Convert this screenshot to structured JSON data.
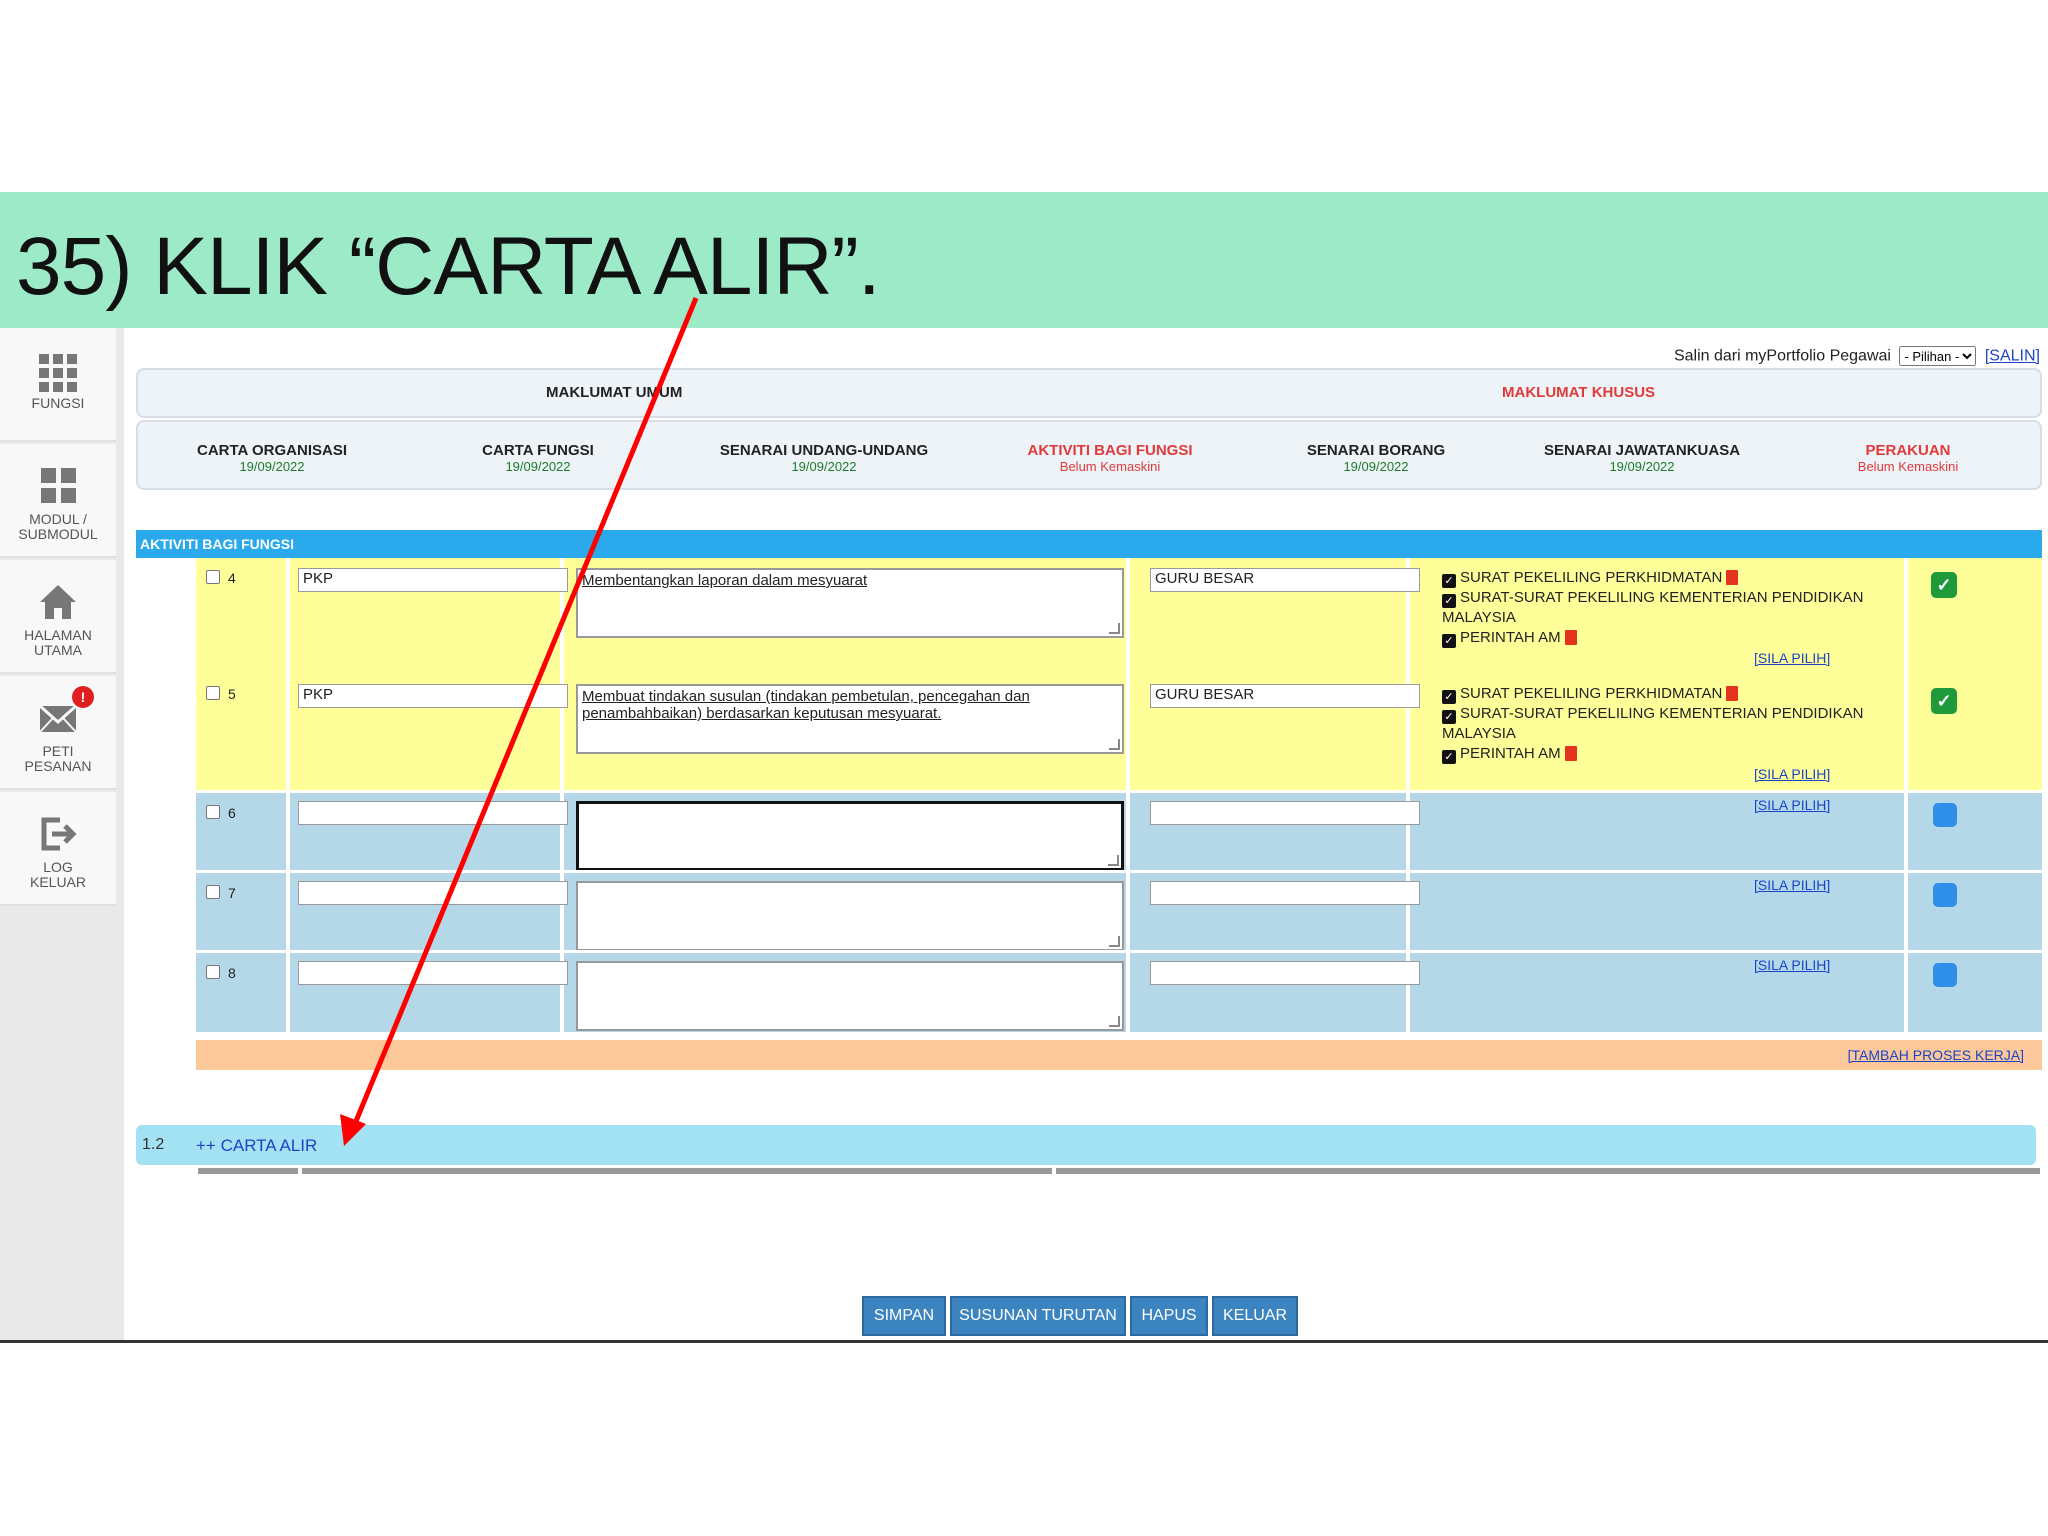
{
  "instruction": "35) KLIK “CARTA ALIR”.",
  "sidebar": {
    "items": [
      {
        "label": "FUNGSI",
        "icon": "grid-icon"
      },
      {
        "label": "MODUL / SUBMODUL",
        "icon": "modules-icon"
      },
      {
        "label": "HALAMAN UTAMA",
        "icon": "home-icon"
      },
      {
        "label": "PETI PESANAN",
        "icon": "mail-icon",
        "badge": "!"
      },
      {
        "label": "LOG KELUAR",
        "icon": "logout-icon"
      }
    ]
  },
  "copy": {
    "label": "Salin dari myPortfolio Pegawai",
    "select_value": "- Pilihan -",
    "link": "[SALIN]"
  },
  "main_tabs": {
    "umum": "MAKLUMAT UMUM",
    "khusus": "MAKLUMAT KHUSUS"
  },
  "sub_tabs": [
    {
      "name": "CARTA ORGANISASI",
      "date": "19/09/2022"
    },
    {
      "name": "CARTA FUNGSI",
      "date": "19/09/2022"
    },
    {
      "name": "SENARAI UNDANG-UNDANG",
      "date": "19/09/2022"
    },
    {
      "name": "AKTIVITI BAGI FUNGSI",
      "date": "Belum Kemaskini"
    },
    {
      "name": "SENARAI BORANG",
      "date": "19/09/2022"
    },
    {
      "name": "SENARAI JAWATANKUASA",
      "date": "19/09/2022"
    },
    {
      "name": "PERAKUAN",
      "date": "Belum Kemaskini"
    }
  ],
  "section_title": "AKTIVITI BAGI FUNGSI",
  "rows": [
    {
      "no": "4",
      "code": "PKP",
      "desc": "Membentangkan laporan dalam mesyuarat",
      "officer": "GURU BESAR",
      "docs": [
        "SURAT PEKELILING PERKHIDMATAN",
        "SURAT-SURAT PEKELILING KEMENTERIAN PENDIDIKAN MALAYSIA",
        "PERINTAH AM"
      ],
      "link": "[SILA PILIH]",
      "status": "done"
    },
    {
      "no": "5",
      "code": "PKP",
      "desc": "Membuat tindakan susulan (tindakan pembetulan, pencegahan dan penambahbaikan)  berdasarkan keputusan mesyuarat.",
      "officer": "GURU BESAR",
      "docs": [
        "SURAT PEKELILING PERKHIDMATAN",
        "SURAT-SURAT PEKELILING KEMENTERIAN PENDIDIKAN MALAYSIA",
        "PERINTAH AM"
      ],
      "link": "[SILA PILIH]",
      "status": "done"
    },
    {
      "no": "6",
      "code": "",
      "desc": "",
      "officer": "",
      "docs": [],
      "link": "[SILA PILIH]",
      "status": "empty"
    },
    {
      "no": "7",
      "code": "",
      "desc": "",
      "officer": "",
      "docs": [],
      "link": "[SILA PILIH]",
      "status": "empty"
    },
    {
      "no": "8",
      "code": "",
      "desc": "",
      "officer": "",
      "docs": [],
      "link": "[SILA PILIH]",
      "status": "empty"
    }
  ],
  "add_process": "[TAMBAH PROSES KERJA]",
  "carta": {
    "num": "1.2",
    "label": "++ CARTA ALIR"
  },
  "buttons": {
    "simpan": "SIMPAN",
    "susunan": "SUSUNAN TURUTAN",
    "hapus": "HAPUS",
    "keluar": "KELUAR"
  },
  "colors": {
    "banner": "#9ceac8",
    "section": "#2aa9ec",
    "filled_row": "#ffff99",
    "empty_row": "#b5d8e9",
    "link": "#1a44c8",
    "arrow": "#ff0000"
  }
}
